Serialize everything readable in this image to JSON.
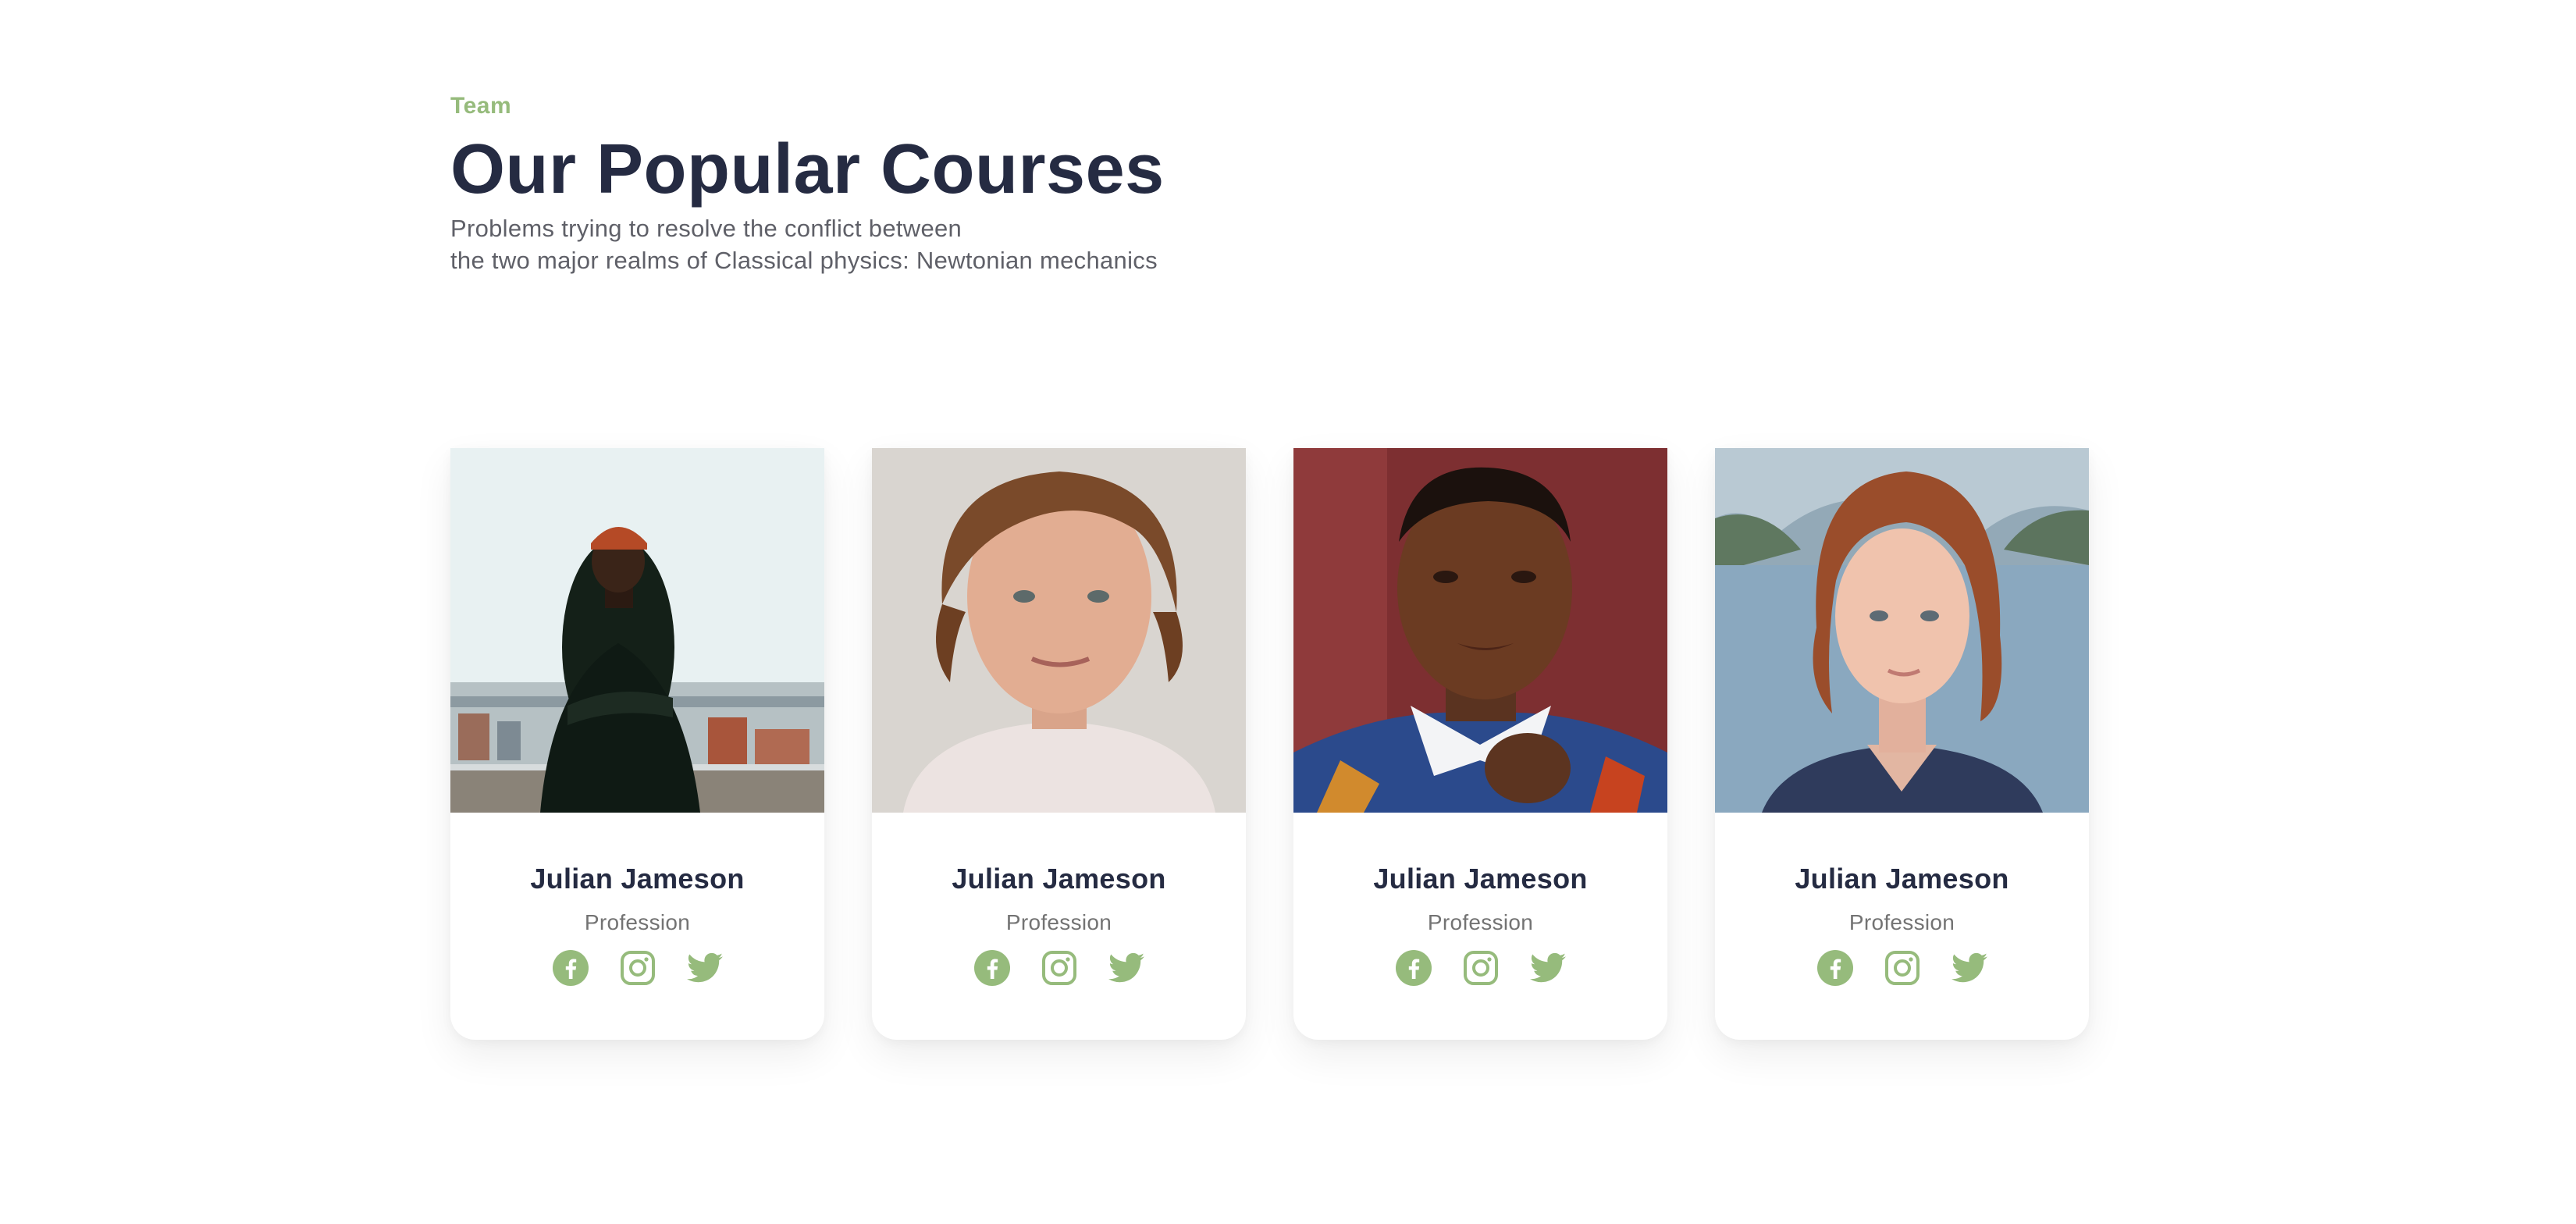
{
  "header": {
    "eyebrow": "Team",
    "title": "Our Popular Courses",
    "subtitle_line1": "Problems trying to resolve the conflict between",
    "subtitle_line2": "the two major realms of Classical physics: Newtonian mechanics"
  },
  "colors": {
    "accent": "#96bb7c",
    "heading": "#252b42",
    "muted": "#737373"
  },
  "team": [
    {
      "name": "Julian Jameson",
      "profession": "Profession",
      "photo": "man-orange-beanie-on-rooftop",
      "socials": [
        "facebook-icon",
        "instagram-icon",
        "twitter-icon"
      ]
    },
    {
      "name": "Julian Jameson",
      "profession": "Profession",
      "photo": "man-curly-hair-portrait",
      "socials": [
        "facebook-icon",
        "instagram-icon",
        "twitter-icon"
      ]
    },
    {
      "name": "Julian Jameson",
      "profession": "Profession",
      "photo": "woman-short-hair-red-wall",
      "socials": [
        "facebook-icon",
        "instagram-icon",
        "twitter-icon"
      ]
    },
    {
      "name": "Julian Jameson",
      "profession": "Profession",
      "photo": "woman-auburn-bob-lake",
      "socials": [
        "facebook-icon",
        "instagram-icon",
        "twitter-icon"
      ]
    }
  ]
}
